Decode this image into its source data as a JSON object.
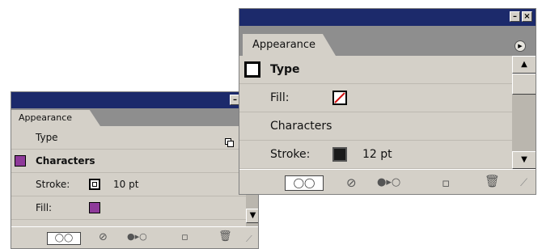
{
  "back_panel": {
    "tab": "Appearance",
    "rows": [
      {
        "label": "Type"
      },
      {
        "label": "Characters",
        "swatch_color": "#8e3a9a"
      },
      {
        "label": "Stroke:",
        "value": "10 pt",
        "swatch_color": "#ffffff"
      },
      {
        "label": "Fill:",
        "swatch_color": "#8e3a9a"
      }
    ]
  },
  "front_panel": {
    "tab": "Appearance",
    "rows": [
      {
        "label": "Type"
      },
      {
        "label": "Fill:",
        "swatch": "none"
      },
      {
        "label": "Characters"
      },
      {
        "label": "Stroke:",
        "value": "12 pt",
        "swatch_color": "#1a1a1a"
      }
    ]
  },
  "colors": {
    "title_bar": "#1c2a6b",
    "panel_bg": "#d4d0c8",
    "tab_strip": "#8e8e8e"
  },
  "footer_icons": [
    "stroke-fill-icon",
    "clear-icon",
    "new-art-icon",
    "duplicate-icon",
    "trash-icon"
  ]
}
